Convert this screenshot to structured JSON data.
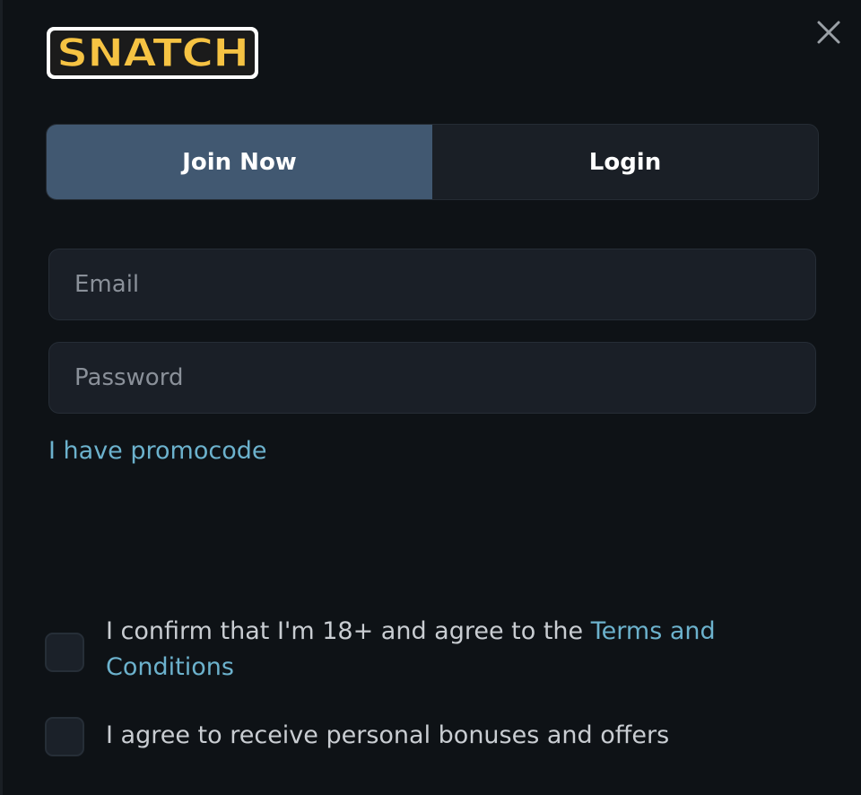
{
  "logo": {
    "text": "SNATCH"
  },
  "tabs": [
    {
      "label": "Join Now",
      "active": true
    },
    {
      "label": "Login",
      "active": false
    }
  ],
  "form": {
    "email": {
      "placeholder": "Email",
      "value": ""
    },
    "password": {
      "placeholder": "Password",
      "value": ""
    },
    "promo_link": "I have promocode"
  },
  "consents": {
    "age": {
      "text": "I confirm that I'm 18+ and agree to the ",
      "link": "Terms and Conditions",
      "checked": false
    },
    "offers": {
      "text": "I agree to receive personal bonuses and offers",
      "checked": false
    }
  },
  "colors": {
    "background": "#0e1216",
    "tab_active": "#415871",
    "link": "#6cb2cd",
    "logo_fill": "#f6c343"
  },
  "icons": {
    "close": "close-icon"
  }
}
